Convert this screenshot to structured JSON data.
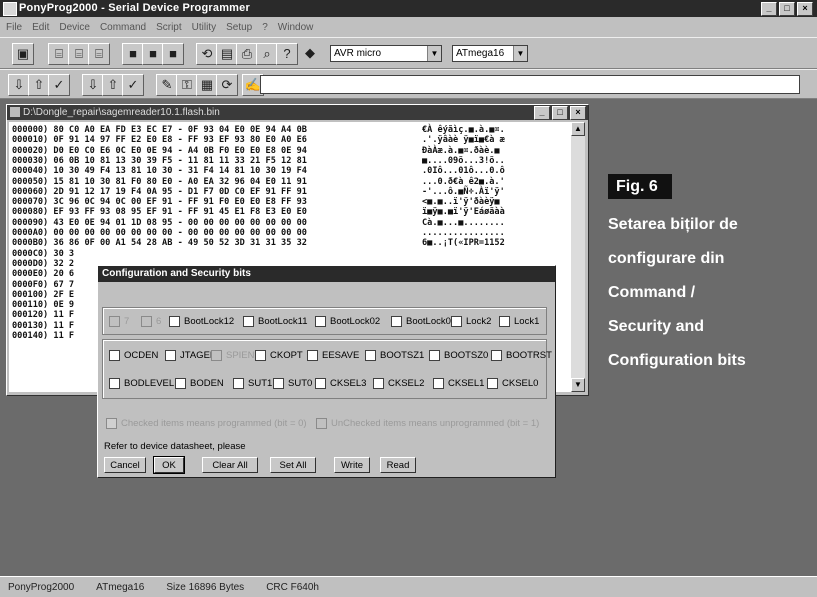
{
  "window": {
    "title": "PonyProg2000 - Serial Device Programmer"
  },
  "menu": [
    "File",
    "Edit",
    "Device",
    "Command",
    "Script",
    "Utility",
    "Setup",
    "?",
    "Window"
  ],
  "toolbar": {
    "device_family": "AVR micro",
    "device_model": "ATmega16"
  },
  "hex_window": {
    "title": "D:\\Dongle_repair\\sagemreader10.1.flash.bin",
    "rows": [
      {
        "addr": "000000)",
        "hex": "80 C0 A0 EA FD E3 EC E7 - 0F 93 04 E0 0E 94 A4 0B",
        "ascii": "€À êýãìç.■.à.■¤."
      },
      {
        "addr": "000010)",
        "hex": "0F 91 14 97 FF E2 E0 E8 - FF 93 EF 93 80 E0 A0 E6",
        "ascii": ".'.ÿâàè ÿ■ï■€à æ"
      },
      {
        "addr": "000020)",
        "hex": "D0 E0 C0 E6 0C E0 0E 94 - A4 0B F0 E0 E0 E8 0E 94",
        "ascii": "ÐàÀæ.à.■¤.ðàè.■"
      },
      {
        "addr": "000030)",
        "hex": "06 0B 10 81 13 30 39 F5 - 11 81 11 33 21 F5 12 81",
        "ascii": "■....09õ...3!õ.."
      },
      {
        "addr": "000040)",
        "hex": "10 30 49 F4 13 81 10 30 - 31 F4 14 81 10 30 19 F4",
        "ascii": ".0Iô...01ô...0.ô"
      },
      {
        "addr": "000050)",
        "hex": "15 81 10 30 81 F0 80 E0 - A0 EA 32 96 04 E0 11 91",
        "ascii": "...0.ð€à ê2■.à.'"
      },
      {
        "addr": "000060)",
        "hex": "2D 91 12 17 19 F4 0A 95 - D1 F7 0D C0 EF 91 FF 91",
        "ascii": "-'...ô.■Ñ÷.Àï'ÿ'"
      },
      {
        "addr": "000070)",
        "hex": "3C 96 0C 94 0C 00 EF 91 - FF 91 F0 E0 E0 E8 FF 93",
        "ascii": "<■.■..ï'ÿ'ðàèÿ■"
      },
      {
        "addr": "000080)",
        "hex": "EF 93 FF 93 08 95 EF 91 - FF 91 45 E1 F8 E3 E0 E0",
        "ascii": "ï■ÿ■.■ï'ÿ'Eáøãàà"
      },
      {
        "addr": "000090)",
        "hex": "43 E0 0E 94 01 1D 08 95 - 00 00 00 00 00 00 00 00",
        "ascii": "Cà.■...■........"
      },
      {
        "addr": "0000A0)",
        "hex": "00 00 00 00 00 00 00 00 - 00 00 00 00 00 00 00 00",
        "ascii": "................"
      },
      {
        "addr": "0000B0)",
        "hex": "36 86 0F 00 A1 54 28 AB - 49 50 52 3D 31 31 35 32",
        "ascii": "6■..¡T(«IPR=1152"
      },
      {
        "addr": "0000C0)",
        "hex": "30 3",
        "ascii": ""
      },
      {
        "addr": "0000D0)",
        "hex": "32 2",
        "ascii": ""
      },
      {
        "addr": "0000E0)",
        "hex": "20 6",
        "ascii": ""
      },
      {
        "addr": "0000F0)",
        "hex": "67 7",
        "ascii": ""
      },
      {
        "addr": "000100)",
        "hex": "2F E",
        "ascii": ""
      },
      {
        "addr": "000110)",
        "hex": "0E 9",
        "ascii": ""
      },
      {
        "addr": "000120)",
        "hex": "11 F",
        "ascii": ""
      },
      {
        "addr": "000130)",
        "hex": "11 F",
        "ascii": ""
      },
      {
        "addr": "000140)",
        "hex": "11 F",
        "ascii": ""
      }
    ]
  },
  "dialog": {
    "title": "Configuration and Security bits",
    "lock_bits": [
      "7",
      "6",
      "BootLock12",
      "BootLock11",
      "BootLock02",
      "BootLock01",
      "Lock2",
      "Lock1"
    ],
    "fuse_row1": [
      "OCDEN",
      "JTAGEN",
      "SPIEN",
      "CKOPT",
      "EESAVE",
      "BOOTSZ1",
      "BOOTSZ0",
      "BOOTRST"
    ],
    "fuse_row2": [
      "BODLEVEL",
      "BODEN",
      "SUT1",
      "SUT0",
      "CKSEL3",
      "CKSEL2",
      "CKSEL1",
      "CKSEL0"
    ],
    "legend_checked": "Checked items means programmed (bit = 0)",
    "legend_unchecked": "UnChecked items means unprogrammed (bit = 1)",
    "note": "Refer to device datasheet, please",
    "buttons": {
      "cancel": "Cancel",
      "ok": "OK",
      "clear_all": "Clear All",
      "set_all": "Set All",
      "write": "Write",
      "read": "Read"
    }
  },
  "status": {
    "app": "PonyProg2000",
    "device": "ATmega16",
    "size": "Size 16896 Bytes",
    "crc": "CRC  F640h"
  },
  "figure": {
    "label": "Fig. 6",
    "caption_lines": [
      "Setarea biților de",
      "configurare din",
      "Command /",
      "Security and",
      "Configuration bits"
    ]
  }
}
